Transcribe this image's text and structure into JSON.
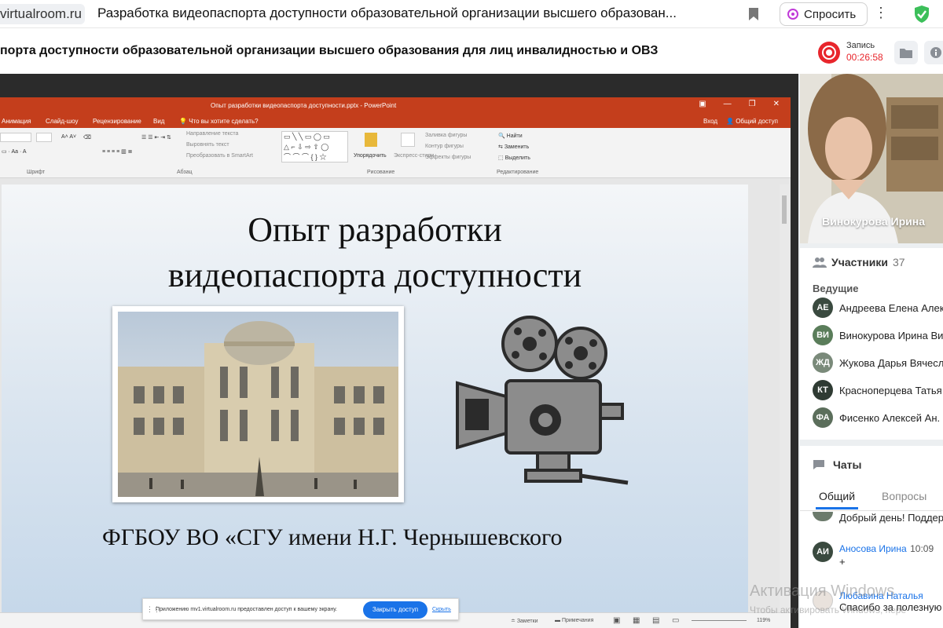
{
  "browser": {
    "url": "virtualroom.ru",
    "tab_title": "Разработка видеопаспорта доступности образовательной организации высшего образован...",
    "ask_label": "Спросить"
  },
  "meeting": {
    "title": "порта доступности образовательной организации высшего образования для лиц инвалидностью и ОВЗ",
    "rec_label": "Запись",
    "rec_time": "00:26:58"
  },
  "ppt": {
    "window_title": "Опыт разработки видеопаспорта доступности.pptx - PowerPoint",
    "tabs": [
      "Анимация",
      "Слайд-шоу",
      "Рецензирование",
      "Вид",
      "Что вы хотите сделать?"
    ],
    "login": "Вход",
    "share": "Общий доступ",
    "ribbon": {
      "text_direction": "Направление текста",
      "align_text": "Выровнять текст",
      "smartart": "Преобразовать в SmartArt",
      "arrange": "Упорядочить",
      "quick_styles": "Экспресс-стили",
      "fill": "Заливка фигуры",
      "outline": "Контур фигуры",
      "effects": "Эффекты фигуры",
      "find": "Найти",
      "replace": "Заменить",
      "select": "Выделить",
      "group_font": "Шрифт",
      "group_paragraph": "Абзац",
      "group_drawing": "Рисование",
      "group_editing": "Редактирование"
    },
    "slide": {
      "title_line1": "Опыт разработки",
      "title_line2": "видеопаспорта доступности",
      "bottom_text": "ФГБОУ ВО «СГУ имени Н.Г. Чернышевского"
    },
    "status": {
      "notes": "Заметки",
      "comments": "Примечания",
      "zoom": "119%"
    }
  },
  "share_banner": {
    "text": "Приложению mv1.virtualroom.ru предоставлен доступ к вашему экрану.",
    "share_button": "Закрыть доступ",
    "hide_link": "Скрыть"
  },
  "video": {
    "name": "Винокурова Ирина"
  },
  "participants": {
    "label": "Участники",
    "count": "37",
    "hosts_label": "Ведущие",
    "items": [
      {
        "initials": "АЕ",
        "name": "Андреева Елена Алек",
        "color": "#3a4a3f"
      },
      {
        "initials": "ВИ",
        "name": "Винокурова Ирина Ви",
        "color": "#5a7d5a"
      },
      {
        "initials": "ЖД",
        "name": "Жукова Дарья Вячесл",
        "color": "#7a8a7a"
      },
      {
        "initials": "КТ",
        "name": "Красноперцева Татья",
        "color": "#2f3b33"
      },
      {
        "initials": "ФА",
        "name": "Фисенко Алексей Ан.",
        "color": "#5b6e5b"
      }
    ]
  },
  "chat": {
    "label": "Чаты",
    "tab_general": "Общий",
    "tab_questions": "Вопросы",
    "messages": [
      {
        "text": "Добрый день! Поддер"
      },
      {
        "initials": "АИ",
        "author": "Аносова Ирина",
        "time": "10:09",
        "text": "+"
      },
      {
        "author": "Любавина Наталья",
        "text": "Спасибо за полезную"
      }
    ]
  },
  "windows_watermark": {
    "title": "Активация Windows",
    "subtitle": "Чтобы активировать Windows, пере"
  }
}
